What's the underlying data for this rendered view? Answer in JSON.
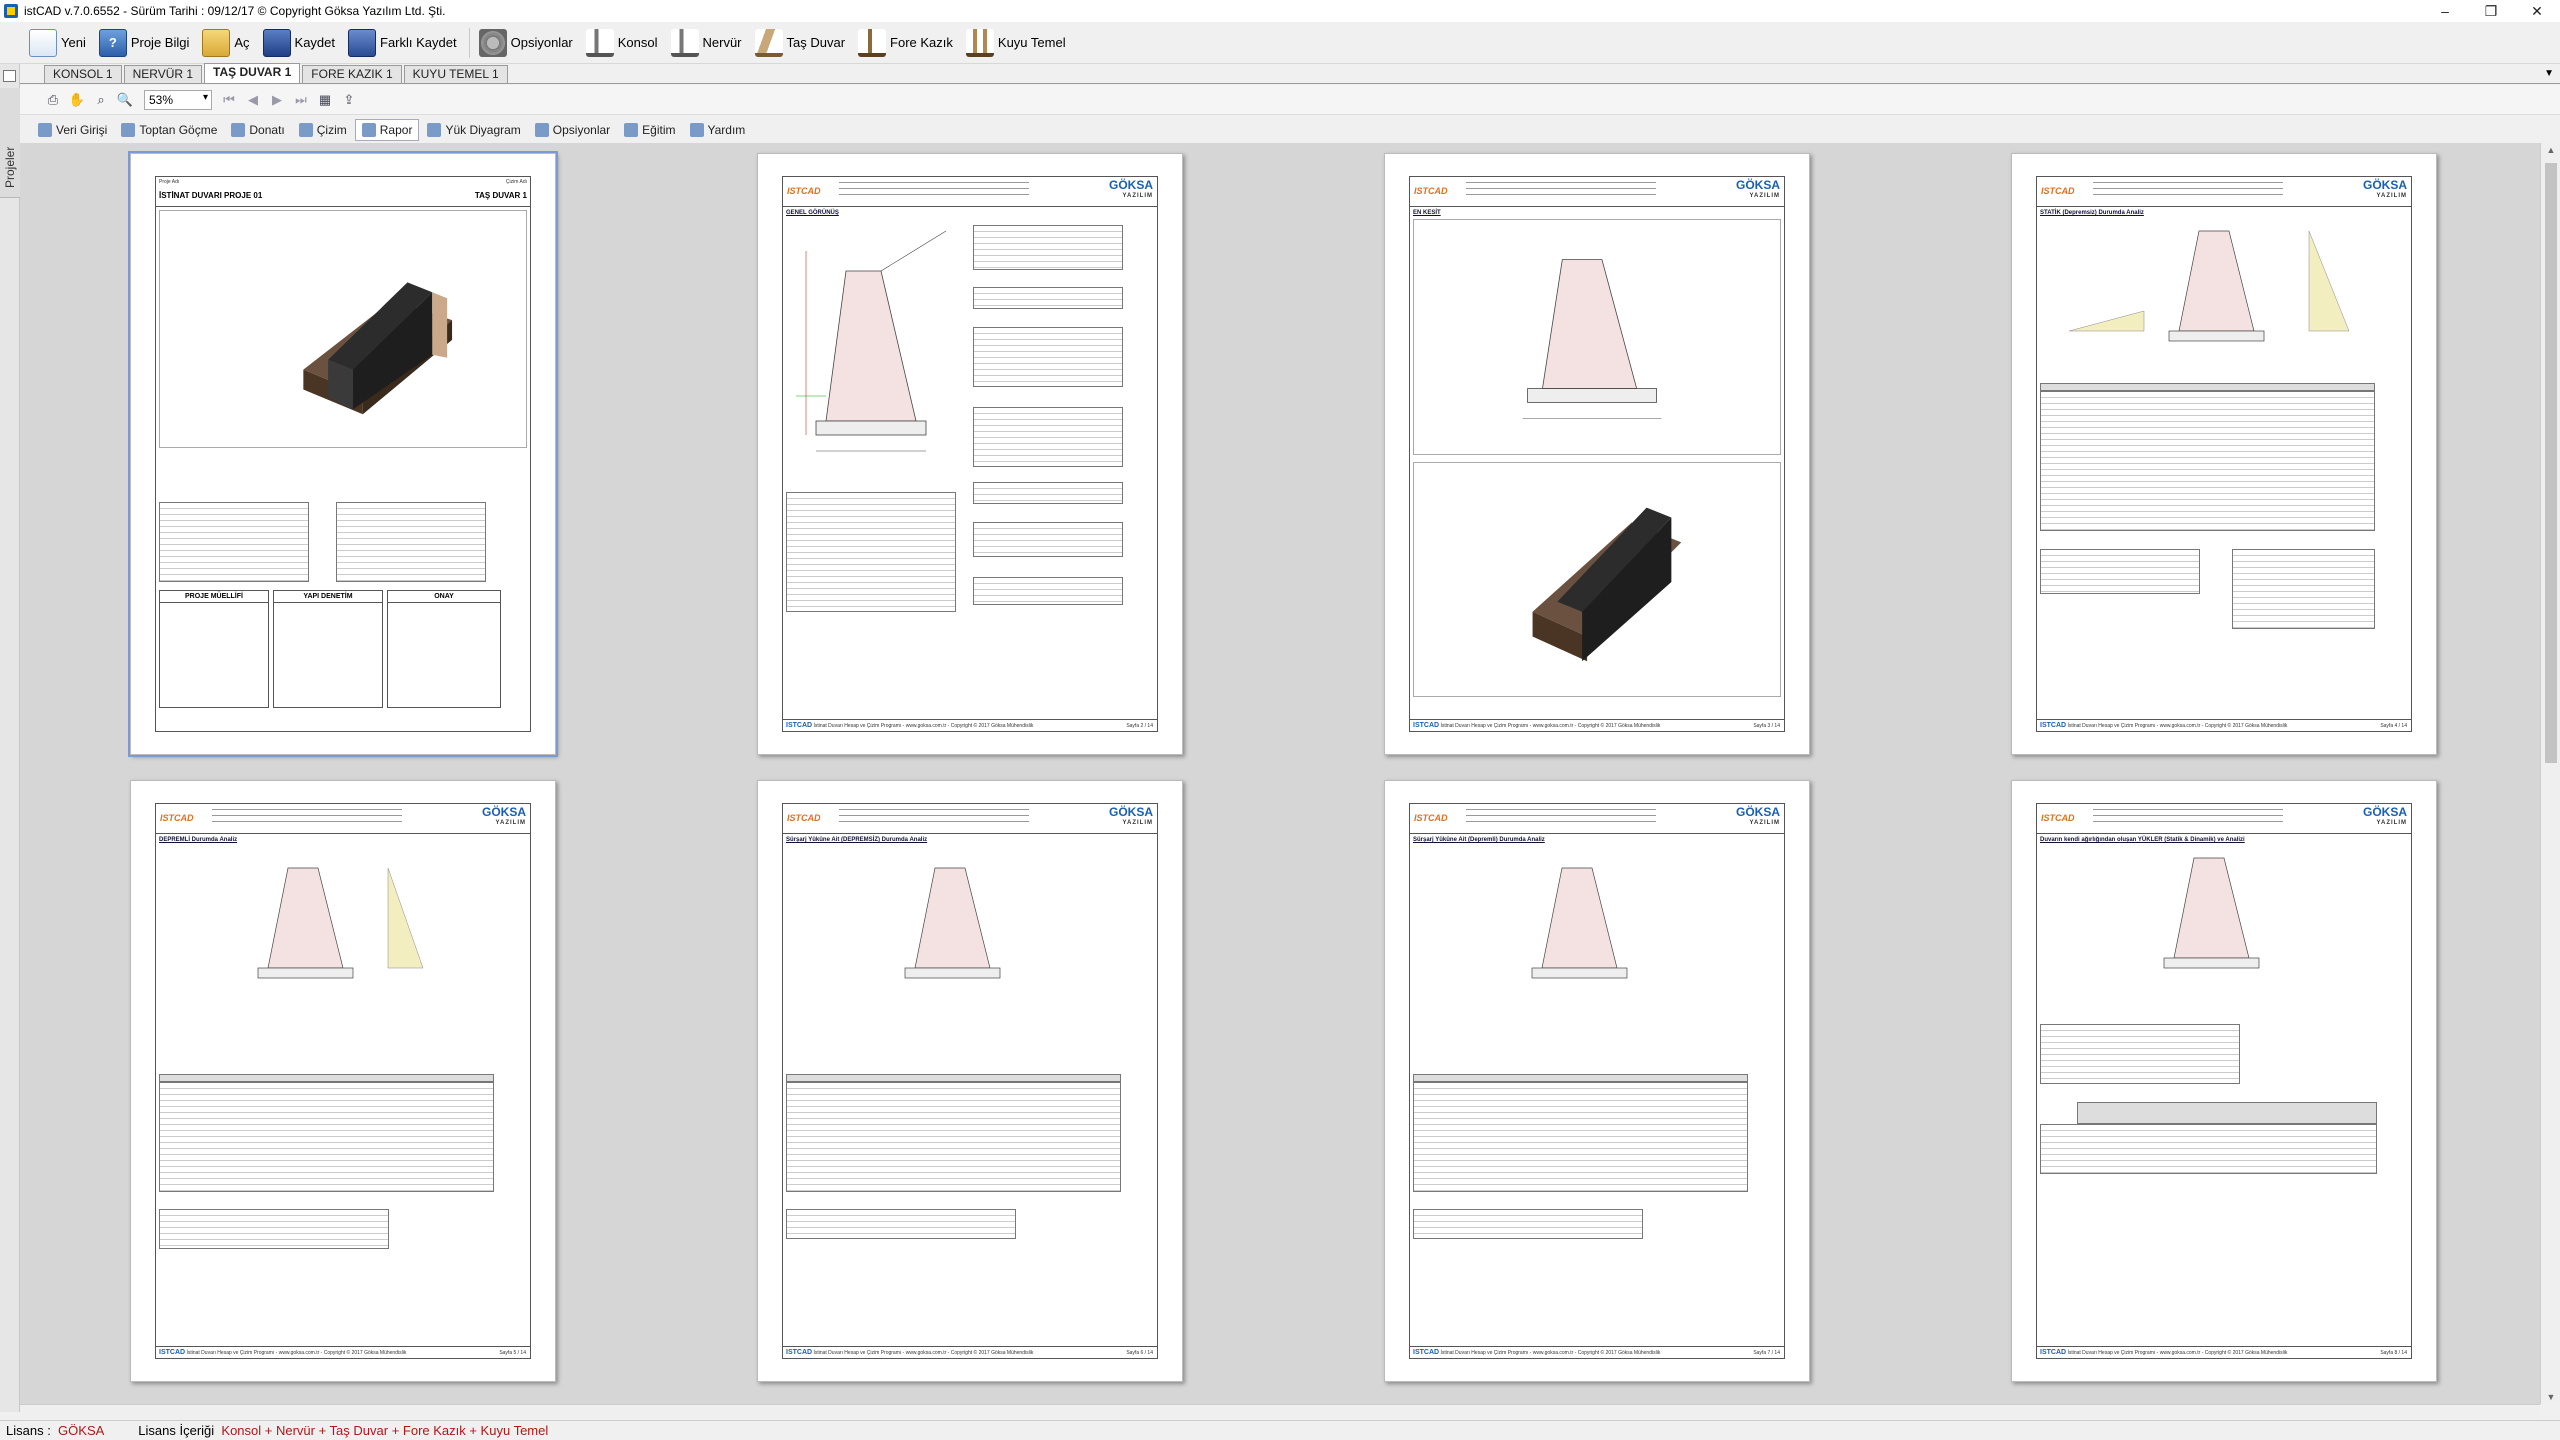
{
  "window": {
    "title": "istCAD v.7.0.6552 - Sürüm Tarihi : 09/12/17  © Copyright Göksa Yazılım Ltd. Şti.",
    "controls": [
      "–",
      "❐",
      "✕"
    ]
  },
  "toolbar": {
    "items": [
      {
        "label": "Yeni",
        "icon": "new-document-icon"
      },
      {
        "label": "Proje Bilgi",
        "icon": "project-info-icon"
      },
      {
        "label": "Aç",
        "icon": "open-folder-icon"
      },
      {
        "label": "Kaydet",
        "icon": "save-disk-icon"
      },
      {
        "label": "Farklı Kaydet",
        "icon": "save-as-icon"
      },
      {
        "label": "Opsiyonlar",
        "icon": "gear-icon"
      },
      {
        "label": "Konsol",
        "icon": "cantilever-wall-icon"
      },
      {
        "label": "Nervür",
        "icon": "counterfort-wall-icon"
      },
      {
        "label": "Taş Duvar",
        "icon": "stone-wall-icon"
      },
      {
        "label": "Fore Kazık",
        "icon": "bored-pile-icon"
      },
      {
        "label": "Kuyu Temel",
        "icon": "well-foundation-icon"
      }
    ]
  },
  "side_panel": {
    "label": "Projeler"
  },
  "doc_tabs": {
    "items": [
      "KONSOL 1",
      "NERVÜR 1",
      "TAŞ DUVAR 1",
      "FORE KAZIK 1",
      "KUYU TEMEL 1"
    ],
    "active": "TAŞ DUVAR 1"
  },
  "preview_toolbar": {
    "zoom": "53%"
  },
  "module_tabs": {
    "items": [
      "Veri Girişi",
      "Toptan Göçme",
      "Donatı",
      "Çizim",
      "Rapor",
      "Yük Diyagram",
      "Opsiyonlar",
      "Eğitim",
      "Yardım"
    ],
    "active": "Rapor"
  },
  "cover_page": {
    "top_left": "Proje Adı",
    "top_right": "Çizim Adı",
    "title": "İSTİNAT DUVARI PROJE 01",
    "subtitle": "TAŞ DUVAR 1",
    "sign_boxes": [
      "PROJE MÜELLİFİ",
      "YAPI DENETİM",
      "ONAY"
    ]
  },
  "report_pages": [
    {
      "title": "GENEL GÖRÜNÜŞ",
      "page_no": "Sayfa 2 / 14"
    },
    {
      "title": "EN KESİT",
      "page_no": "Sayfa 3 / 14"
    },
    {
      "title": "STATİK (Depremsiz) Durumda Analiz",
      "page_no": "Sayfa 4 / 14"
    },
    {
      "title": "DEPREMLİ Durumda Analiz",
      "page_no": "Sayfa 5 / 14"
    },
    {
      "title": "Sürşarj Yüküne Ait (DEPREMSİZ) Durumda Analiz",
      "page_no": "Sayfa 6 / 14"
    },
    {
      "title": "Sürşarj Yüküne Ait (Depremli) Durumda Analiz",
      "page_no": "Sayfa 7 / 14"
    },
    {
      "title": "Duvarın kendi ağırlığından oluşan YÜKLER (Statik & Dinamik) ve Analizi",
      "page_no": "Sayfa 8 / 14"
    }
  ],
  "page_branding": {
    "left_logo": "ISTCAD",
    "right_logo": "GÖKSA",
    "right_logo_sub": "YAZILIM",
    "footer_logo": "ISTCAD",
    "footer_text": "İstinat Duvarı Hesap ve Çizim Programı - www.goksa.com.tr - Copyright © 2017 Göksa Mühendislik"
  },
  "status": {
    "license_label": "Lisans :",
    "license_value": "GÖKSA",
    "content_label": "Lisans İçeriği",
    "content_value": "Konsol + Nervür + Taş Duvar + Fore Kazık + Kuyu Temel"
  }
}
